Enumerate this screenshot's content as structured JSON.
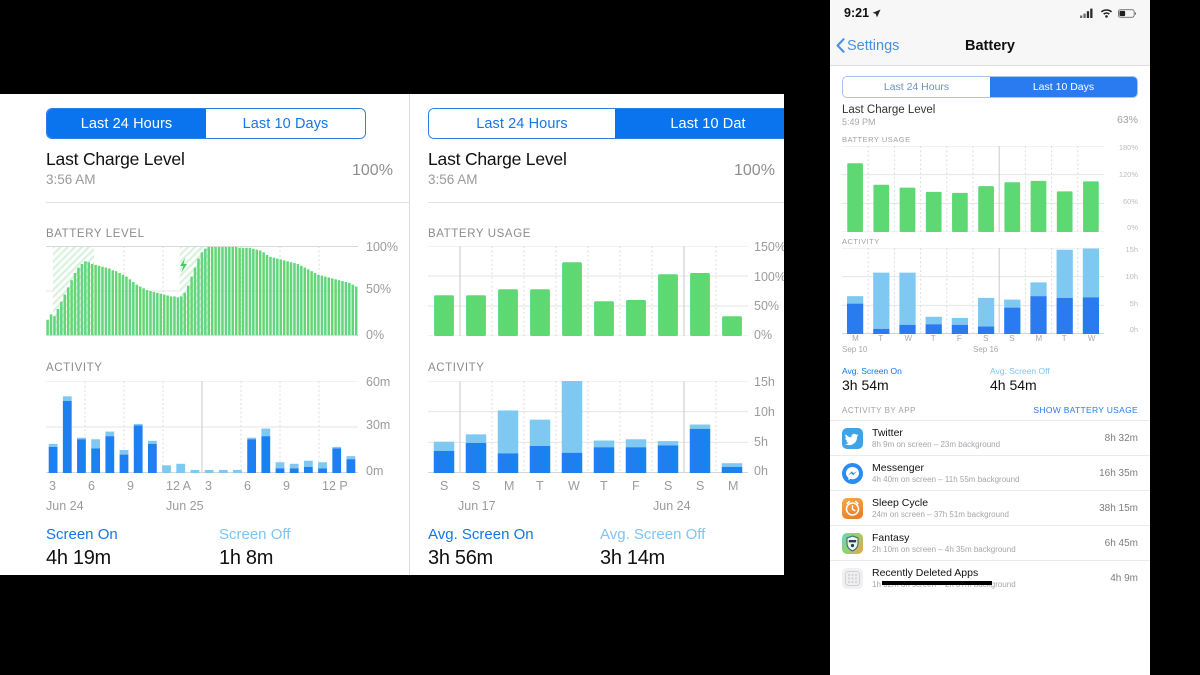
{
  "meta": {
    "accent_blue": "#0a74ef",
    "green": "#5ed873",
    "blue_dark": "#1d7ff0",
    "blue_light": "#7ec8f2"
  },
  "panel_left": {
    "segmented": {
      "options": [
        "Last 24 Hours",
        "Last 10 Days"
      ],
      "selected": "Last 24 Hours"
    },
    "charge": {
      "title": "Last Charge Level",
      "time": "3:56 AM",
      "percent": "100%"
    },
    "battery_section_label": "BATTERY LEVEL",
    "activity_section_label": "ACTIVITY",
    "stats": [
      {
        "label": "Screen On",
        "value": "4h 19m"
      },
      {
        "label": "Screen Off",
        "value": "1h 8m"
      }
    ],
    "battery_y_ticks": [
      "100%",
      "50%",
      "0%"
    ],
    "activity_y_ticks": [
      "60m",
      "30m",
      "0m"
    ],
    "activity_x_ticks": [
      "3",
      "6",
      "9",
      "12 A",
      "3",
      "6",
      "9",
      "12 P"
    ],
    "activity_x_dates": [
      "Jun 24",
      "Jun 25"
    ],
    "charge_icon": "lightning-bolt"
  },
  "panel_middle": {
    "segmented": {
      "options": [
        "Last 24 Hours",
        "Last 10 Dat"
      ],
      "selected": "Last 10 Dat"
    },
    "charge": {
      "title": "Last Charge Level",
      "time": "3:56 AM",
      "percent": "100%"
    },
    "usage_section_label": "BATTERY USAGE",
    "activity_section_label": "ACTIVITY",
    "stats": [
      {
        "label": "Avg. Screen On",
        "value": "3h 56m"
      },
      {
        "label": "Avg. Screen Off",
        "value": "3h 14m"
      }
    ],
    "usage_y_ticks": [
      "150%",
      "100%",
      "50%",
      "0%"
    ],
    "activity_y_ticks": [
      "15h",
      "10h",
      "5h",
      "0h"
    ],
    "activity_x_ticks": [
      "S",
      "S",
      "M",
      "T",
      "W",
      "T",
      "F",
      "S",
      "S",
      "M"
    ],
    "activity_x_dates": [
      "Jun 17",
      "Jun 24"
    ]
  },
  "panel_phone": {
    "status": {
      "time": "9:21",
      "location_icon": "location-arrow",
      "signal_icon": "cellular-bars",
      "wifi_icon": "wifi",
      "battery_icon": "battery"
    },
    "nav": {
      "back": "Settings",
      "title": "Battery"
    },
    "segmented": {
      "options": [
        "Last 24 Hours",
        "Last 10 Days"
      ],
      "selected": "Last 10 Days"
    },
    "charge": {
      "title": "Last Charge Level",
      "time": "5:49 PM",
      "percent": "63%"
    },
    "usage_section_label": "BATTERY USAGE",
    "activity_section_label": "ACTIVITY",
    "usage_y_ticks": [
      "180%",
      "120%",
      "60%",
      "0%"
    ],
    "activity_y_ticks": [
      "15h",
      "10h",
      "5h",
      "0h"
    ],
    "activity_x_ticks": [
      "M",
      "T",
      "W",
      "T",
      "F",
      "S",
      "S",
      "M",
      "T",
      "W"
    ],
    "activity_x_dates": [
      "Sep 10",
      "Sep 16"
    ],
    "stats": [
      {
        "label": "Avg. Screen On",
        "value": "3h 54m"
      },
      {
        "label": "Avg. Screen Off",
        "value": "4h 54m"
      }
    ],
    "activity_by_app": {
      "label": "ACTIVITY BY APP",
      "action": "SHOW BATTERY USAGE"
    },
    "apps": [
      {
        "name": "Twitter",
        "sub": "8h 9m on screen – 23m background",
        "time": "8h 32m",
        "icon": "twitter-icon",
        "icon_color": "#3fa3e8",
        "redacted": false
      },
      {
        "name": "Messenger",
        "sub": "4h 40m on screen – 11h 55m background",
        "time": "16h 35m",
        "icon": "messenger-icon",
        "icon_color": "#2a8bf2",
        "redacted": false
      },
      {
        "name": "Sleep Cycle",
        "sub": "24m on screen – 37h 51m background",
        "time": "38h 15m",
        "icon": "sleep-cycle-icon",
        "icon_color": "#ef8a33",
        "redacted": false
      },
      {
        "name": "Fantasy",
        "sub": "2h 10m on screen – 4h 35m background",
        "time": "6h 45m",
        "icon": "fantasy-icon",
        "icon_color": "#5ec9a8",
        "redacted": false
      },
      {
        "name": "Recently Deleted Apps",
        "sub": "1h 32m on screen – 2h 37m background",
        "time": "4h 9m",
        "icon": "recently-deleted-icon",
        "icon_color": "#e9e9ec",
        "redacted": true
      }
    ]
  },
  "chart_data": [
    {
      "id": "left-battery-level",
      "type": "area",
      "title": "BATTERY LEVEL",
      "xlabel": "",
      "ylabel": "",
      "ylim": [
        0,
        100
      ],
      "yticks": [
        0,
        50,
        100
      ],
      "ytick_labels": [
        "0%",
        "50%",
        "100%"
      ],
      "xtick_labels": [
        "3",
        "6",
        "9",
        "12 A",
        "3",
        "6",
        "9",
        "12 P"
      ],
      "grid": true,
      "values": [
        18,
        24,
        22,
        30,
        38,
        46,
        54,
        62,
        70,
        76,
        80,
        83,
        82,
        80,
        79,
        78,
        77,
        76,
        75,
        73,
        72,
        70,
        68,
        66,
        63,
        60,
        57,
        55,
        53,
        51,
        50,
        49,
        48,
        47,
        46,
        45,
        44,
        44,
        43,
        44,
        48,
        56,
        66,
        76,
        86,
        93,
        97,
        99,
        99,
        99,
        99,
        99,
        99,
        99,
        99,
        99,
        98,
        98,
        98,
        98,
        97,
        96,
        95,
        93,
        90,
        88,
        87,
        86,
        85,
        84,
        83,
        82,
        81,
        80,
        78,
        76,
        74,
        72,
        70,
        68,
        67,
        66,
        65,
        64,
        63,
        62,
        61,
        60,
        59,
        57,
        55
      ],
      "charging_segments": [
        [
          2,
          13
        ],
        [
          39,
          47
        ]
      ]
    },
    {
      "id": "left-activity",
      "type": "bar",
      "title": "ACTIVITY",
      "stacked": true,
      "ylim": [
        0,
        60
      ],
      "yticks": [
        0,
        30,
        60
      ],
      "ytick_labels": [
        "0m",
        "30m",
        "60m"
      ],
      "xtick_labels": [
        "3",
        "6",
        "9",
        "12 A",
        "3",
        "6",
        "9",
        "12 P"
      ],
      "xtick_dates": [
        "Jun 24",
        "Jun 25"
      ],
      "series": [
        {
          "name": "Screen On",
          "color": "#1d7ff0",
          "values": [
            17,
            47,
            22,
            16,
            24,
            12,
            31,
            19,
            0,
            0,
            0,
            0,
            0,
            0,
            22,
            24,
            3,
            3,
            4,
            3,
            16,
            9
          ]
        },
        {
          "name": "Screen Off",
          "color": "#7ec8f2",
          "values": [
            2,
            3,
            1,
            6,
            3,
            3,
            1,
            2,
            5,
            6,
            2,
            2,
            2,
            2,
            1,
            5,
            4,
            3,
            4,
            4,
            1,
            2
          ]
        }
      ]
    },
    {
      "id": "mid-battery-usage",
      "type": "bar",
      "title": "BATTERY USAGE",
      "ylim": [
        0,
        150
      ],
      "yticks": [
        0,
        50,
        100,
        150
      ],
      "ytick_labels": [
        "0%",
        "50%",
        "100%",
        "150%"
      ],
      "categories": [
        "S",
        "S",
        "M",
        "T",
        "W",
        "T",
        "F",
        "S",
        "S",
        "M"
      ],
      "values": [
        68,
        68,
        78,
        78,
        123,
        58,
        60,
        103,
        105,
        33
      ],
      "color": "#5ed873"
    },
    {
      "id": "mid-activity",
      "type": "bar",
      "title": "ACTIVITY",
      "stacked": true,
      "ylim": [
        0,
        15
      ],
      "yticks": [
        0,
        5,
        10,
        15
      ],
      "ytick_labels": [
        "0h",
        "5h",
        "10h",
        "15h"
      ],
      "categories": [
        "S",
        "S",
        "M",
        "T",
        "W",
        "T",
        "F",
        "S",
        "S",
        "M"
      ],
      "xtick_dates": [
        "Jun 17",
        "Jun 24"
      ],
      "series": [
        {
          "name": "Screen On",
          "color": "#1d7ff0",
          "values": [
            3.6,
            4.9,
            3.2,
            4.4,
            3.3,
            4.2,
            4.2,
            4.5,
            7.2,
            1.0
          ]
        },
        {
          "name": "Screen Off",
          "color": "#7ec8f2",
          "values": [
            1.5,
            1.4,
            7.0,
            4.3,
            11.7,
            1.1,
            1.3,
            0.7,
            0.7,
            0.6
          ]
        }
      ]
    },
    {
      "id": "phone-battery-usage",
      "type": "bar",
      "title": "BATTERY USAGE",
      "ylim": [
        0,
        180
      ],
      "yticks": [
        0,
        60,
        120,
        180
      ],
      "ytick_labels": [
        "0%",
        "60%",
        "120%",
        "180%"
      ],
      "categories": [
        "M",
        "T",
        "W",
        "T",
        "F",
        "S",
        "S",
        "M",
        "T",
        "W"
      ],
      "values": [
        144,
        99,
        93,
        84,
        82,
        96,
        104,
        107,
        85,
        106
      ],
      "color": "#5ed873"
    },
    {
      "id": "phone-activity",
      "type": "bar",
      "title": "ACTIVITY",
      "stacked": true,
      "ylim": [
        0,
        15
      ],
      "yticks": [
        0,
        5,
        10,
        15
      ],
      "ytick_labels": [
        "0h",
        "5h",
        "10h",
        "15h"
      ],
      "categories": [
        "M",
        "T",
        "W",
        "T",
        "F",
        "S",
        "S",
        "M",
        "T",
        "W"
      ],
      "xtick_dates": [
        "Sep 10",
        "Sep 16"
      ],
      "series": [
        {
          "name": "Screen On",
          "color": "#2a7bef",
          "values": [
            5.3,
            0.9,
            1.6,
            1.7,
            1.6,
            1.3,
            4.6,
            6.6,
            6.3,
            6.4
          ]
        },
        {
          "name": "Screen Off",
          "color": "#7ec8f2",
          "values": [
            1.3,
            9.8,
            9.1,
            1.3,
            1.2,
            5.0,
            1.4,
            2.4,
            8.4,
            8.5
          ]
        }
      ]
    }
  ]
}
